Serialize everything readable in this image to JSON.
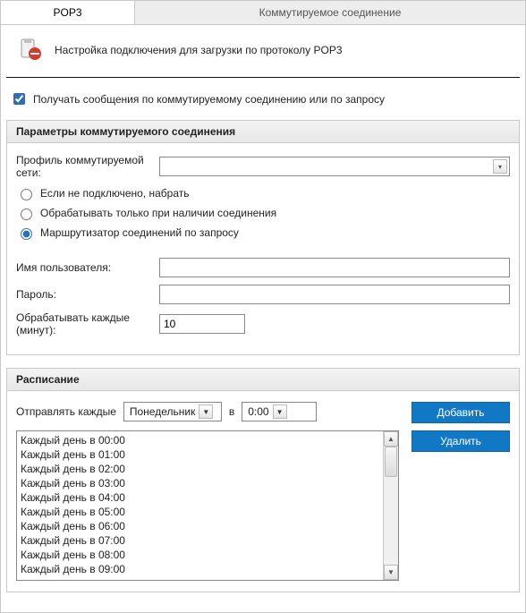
{
  "tabs": {
    "pop3": "POP3",
    "dialup": "Коммутируемое соединение"
  },
  "header": {
    "title": "Настройка подключения для загрузки по протоколу POP3"
  },
  "mainCheck": {
    "label": "Получать сообщения по коммутируемому соединению или по запросу"
  },
  "dial": {
    "groupTitle": "Параметры коммутируемого соединения",
    "profileLabel": "Профиль коммутируемой сети:",
    "radios": {
      "r1": "Если не подключено, набрать",
      "r2": "Обрабатывать только при наличии соединения",
      "r3": "Маршрутизатор соединений по запросу"
    },
    "userLabel": "Имя пользователя:",
    "userValue": "",
    "passLabel": "Пароль:",
    "passValue": "",
    "intervalLabel": "Обрабатывать каждые (минут):",
    "intervalValue": "10"
  },
  "sched": {
    "groupTitle": "Расписание",
    "sendEvery": "Отправлять каждые",
    "atWord": "в",
    "daySelected": "Понедельник",
    "timeSelected": "0:00",
    "addBtn": "Добавить",
    "delBtn": "Удалить",
    "items": [
      "Каждый день в 00:00",
      "Каждый день в 01:00",
      "Каждый день в 02:00",
      "Каждый день в 03:00",
      "Каждый день в 04:00",
      "Каждый день в 05:00",
      "Каждый день в 06:00",
      "Каждый день в 07:00",
      "Каждый день в 08:00",
      "Каждый день в 09:00"
    ]
  }
}
